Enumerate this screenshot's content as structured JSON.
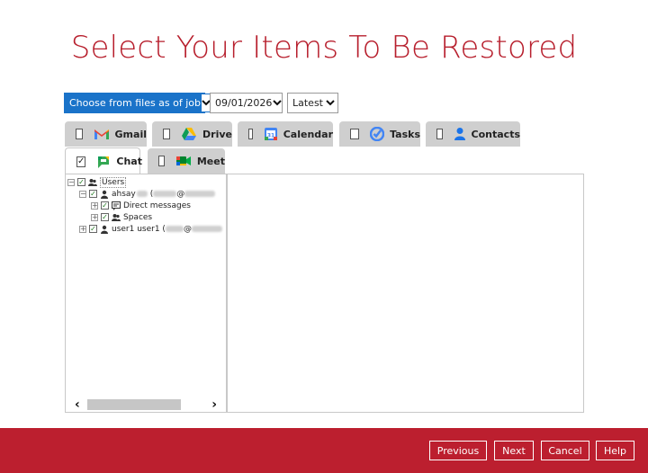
{
  "page": {
    "title": "Select Your Items To Be Restored"
  },
  "job": {
    "source": "Choose from files as of job",
    "date": "09/01/2026",
    "version": "Latest"
  },
  "tabs": [
    {
      "label": "Gmail",
      "checked": false,
      "icon": "gmail-icon"
    },
    {
      "label": "Drive",
      "checked": false,
      "icon": "drive-icon"
    },
    {
      "label": "Calendar",
      "checked": false,
      "icon": "calendar-icon"
    },
    {
      "label": "Tasks",
      "checked": false,
      "icon": "tasks-icon"
    },
    {
      "label": "Contacts",
      "checked": false,
      "icon": "contacts-icon"
    },
    {
      "label": "Chat",
      "checked": true,
      "check": "✓",
      "active": true,
      "icon": "chat-icon"
    },
    {
      "label": "Meet",
      "checked": false,
      "icon": "meet-icon"
    }
  ],
  "tree": {
    "root": "Users",
    "user1": "ahsay",
    "user1_open": "(",
    "at_sign": "@",
    "direct_messages": "Direct messages",
    "spaces": "Spaces",
    "user2": "user1 user1 ("
  },
  "footer": {
    "previous": "Previous",
    "next": "Next",
    "cancel": "Cancel",
    "help": "Help"
  },
  "colors": {
    "brand": "#bc1f2f",
    "title": "#b71e2c",
    "select_accent": "#1a73c9"
  }
}
